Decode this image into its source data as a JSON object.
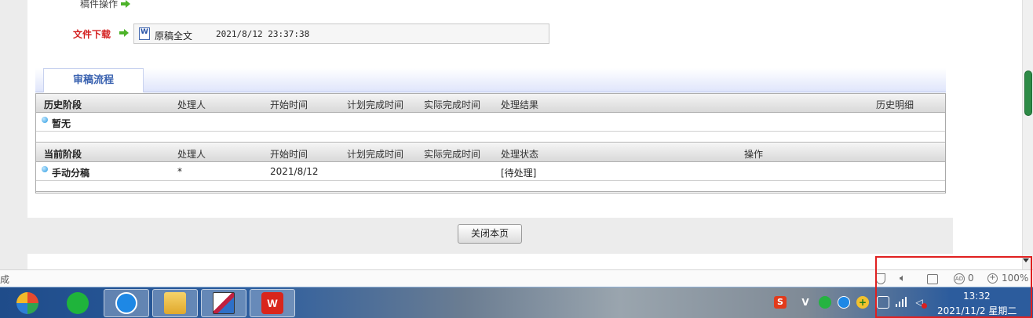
{
  "operations": {
    "label": "稿件操作"
  },
  "download": {
    "label": "文件下载",
    "file_name": "原稿全文",
    "timestamp": "2021/8/12 23:37:38"
  },
  "flow": {
    "tab_label": "审稿流程",
    "history": {
      "headers": [
        "历史阶段",
        "处理人",
        "开始时间",
        "计划完成时间",
        "实际完成时间",
        "处理结果",
        "历史明细"
      ],
      "rows": [
        {
          "stage": "暂无"
        }
      ]
    },
    "current": {
      "headers": [
        "当前阶段",
        "处理人",
        "开始时间",
        "计划完成时间",
        "实际完成时间",
        "处理状态",
        "操作"
      ],
      "rows": [
        {
          "stage": "手动分稿",
          "handler": "*",
          "start": "2021/8/12",
          "status": "[待处理]"
        }
      ]
    }
  },
  "close_button": {
    "label": "关闭本页"
  },
  "statusbar": {
    "left_text": "成",
    "adblock_count": "0",
    "zoom": "100%",
    "adblock_icon_text": "AD",
    "zoom_icon_text": "+"
  },
  "taskbar": {
    "wps_label": "W",
    "tray_sogou_label": "S",
    "tray_v_label": "V",
    "tray_plus_label": "+",
    "tray_vol_label": "◁",
    "time": "13:32",
    "date": "2021/11/2 星期二"
  },
  "colors": {
    "accent_red": "#d42020",
    "arrow_green": "#4db32a",
    "tab_blue": "#3a62b0",
    "scroll_green": "#2e8b47",
    "highlight": "#e02020"
  },
  "icons": [
    "green-arrow-icon",
    "word-doc-icon",
    "bullet-icon",
    "shield-icon",
    "speaker-icon",
    "lock-icon",
    "adblock-icon",
    "zoom-icon"
  ]
}
